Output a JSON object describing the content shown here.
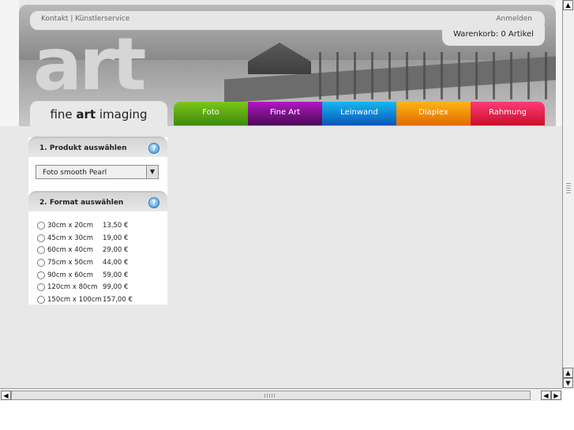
{
  "topbar": {
    "links": [
      "Kontakt",
      "Künstlerservice"
    ],
    "separator": " | ",
    "login": "Anmelden"
  },
  "cart": {
    "label": "Warenkorb: 0 Artikel"
  },
  "brand": {
    "logo_text": "art",
    "tab_prefix": "fine ",
    "tab_bold": "art",
    "tab_suffix": " imaging"
  },
  "nav": [
    {
      "label": "Foto",
      "color_top": "#7cc61a",
      "color_bottom": "#3d8a0c"
    },
    {
      "label": "Fine Art",
      "color_top": "#b216c4",
      "color_bottom": "#4a0a52"
    },
    {
      "label": "Leinwand",
      "color_top": "#18b6f0",
      "color_bottom": "#0a56b8"
    },
    {
      "label": "Diaplex",
      "color_top": "#ffb516",
      "color_bottom": "#e06a00"
    },
    {
      "label": "Rahmung",
      "color_top": "#ff3a76",
      "color_bottom": "#c8102a"
    }
  ],
  "product_panel": {
    "title": "1. Produkt auswählen",
    "help": "?",
    "selected": "Foto smooth Pearl",
    "arrow": "▼"
  },
  "format_panel": {
    "title": "2. Format auswählen",
    "help": "?",
    "options": [
      {
        "size": "30cm x 20cm",
        "price": "13,50 €"
      },
      {
        "size": "45cm x 30cm",
        "price": "19,00 €"
      },
      {
        "size": "60cm x 40cm",
        "price": "29,00 €"
      },
      {
        "size": "75cm x 50cm",
        "price": "44,00 €"
      },
      {
        "size": "90cm x 60cm",
        "price": "59,00 €"
      },
      {
        "size": "120cm x 80cm",
        "price": "99,00 €"
      },
      {
        "size": "150cm x 100cm",
        "price": "157,00 €"
      }
    ]
  },
  "scroll": {
    "up": "▲",
    "down": "▼",
    "left": "◀",
    "right": "▶"
  }
}
